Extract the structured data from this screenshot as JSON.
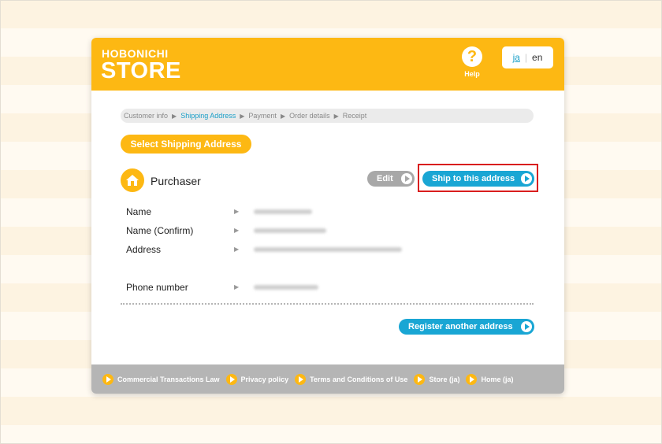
{
  "header": {
    "logo_small": "HOBONICHI",
    "logo_big": "STORE",
    "help_glyph": "?",
    "help_label": "Help",
    "lang_ja": "ja",
    "lang_sep": "|",
    "lang_en": "en"
  },
  "steps": [
    {
      "label": "Customer info",
      "active": false
    },
    {
      "label": "Shipping Address",
      "active": true
    },
    {
      "label": "Payment",
      "active": false
    },
    {
      "label": "Order details",
      "active": false
    },
    {
      "label": "Receipt",
      "active": false
    }
  ],
  "section_title": "Select Shipping Address",
  "purchaser": {
    "title": "Purchaser",
    "edit_label": "Edit",
    "ship_label": "Ship to this address"
  },
  "fields": [
    {
      "label": "Name"
    },
    {
      "label": "Name (Confirm)"
    },
    {
      "label": "Address"
    },
    {
      "label": "Phone number"
    }
  ],
  "register_label": "Register another address",
  "footer": {
    "links": [
      "Commercial Transactions Law",
      "Privacy policy",
      "Terms and Conditions of Use",
      "Store (ja)",
      "Home (ja)"
    ]
  },
  "colors": {
    "brand_yellow": "#fdb813",
    "accent_blue": "#19a6d4",
    "highlight_red": "#d91e1e",
    "footer_gray": "#b5b5b5"
  }
}
